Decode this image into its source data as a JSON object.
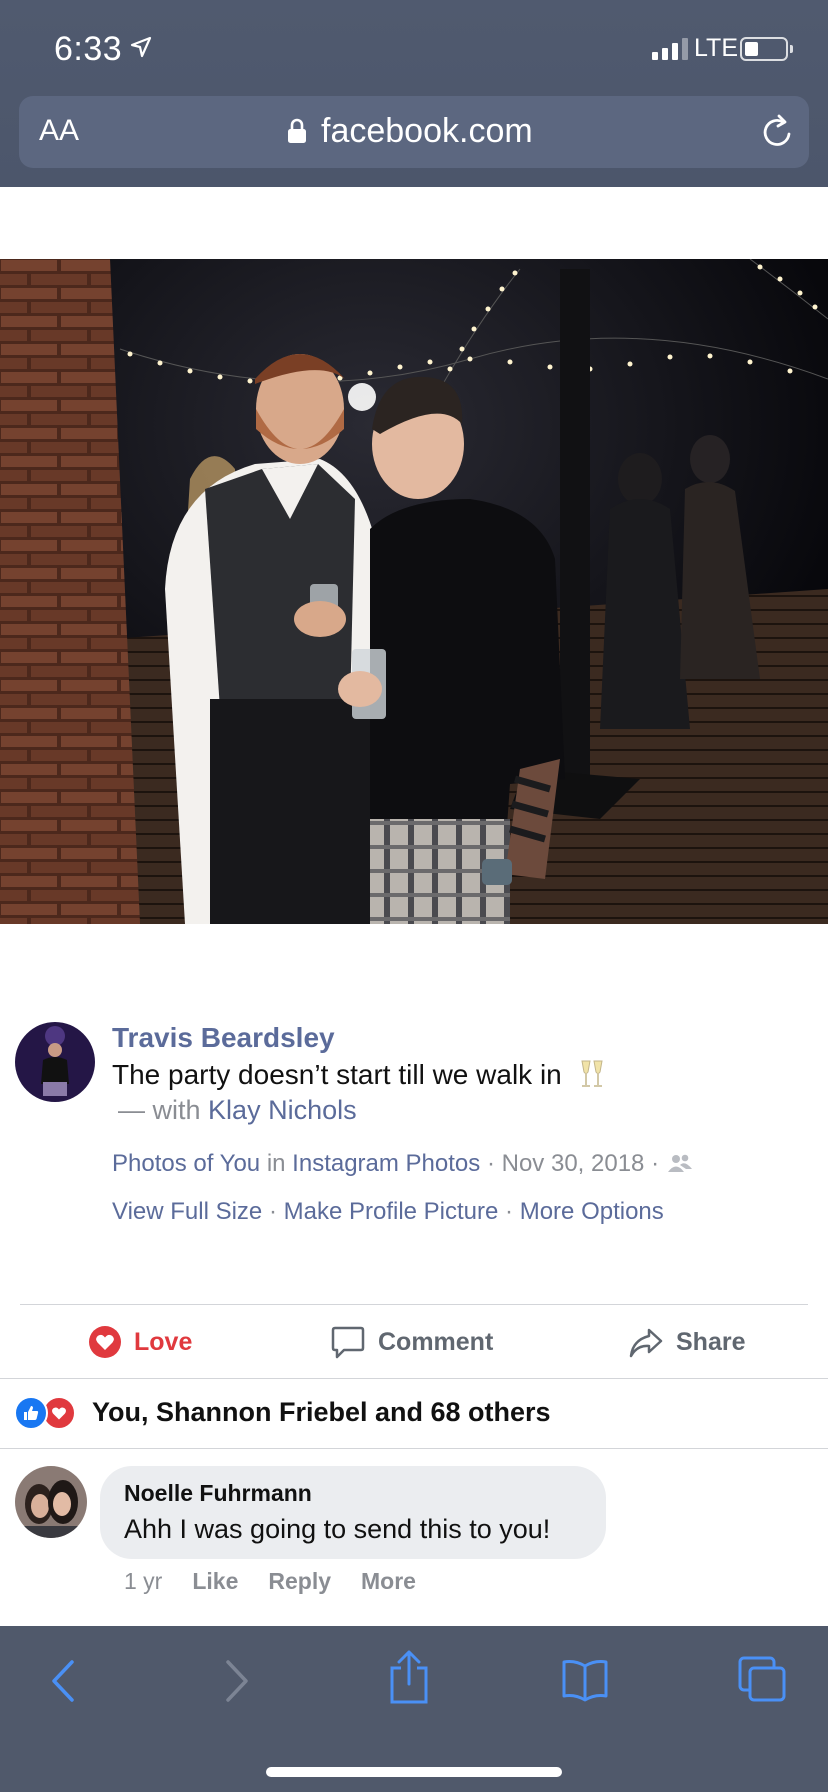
{
  "status_bar": {
    "time": "6:33",
    "network": "LTE"
  },
  "browser": {
    "text_size_label": "AA",
    "url": "facebook.com"
  },
  "post": {
    "author": "Travis Beardsley",
    "caption": "The party doesn’t start till we walk in",
    "caption_emoji": "champagne-glasses-icon",
    "with_prefix": "—  with",
    "tagged": "Klay Nichols",
    "album": "Photos of You",
    "in_label": "in",
    "source": "Instagram Photos",
    "date": "Nov 30, 2018",
    "separator": "·",
    "options": {
      "view_full_size": "View Full Size",
      "make_profile_picture": "Make Profile Picture",
      "more_options": "More Options"
    }
  },
  "actions": {
    "love": "Love",
    "comment": "Comment",
    "share": "Share"
  },
  "reactions": {
    "summary": "You, Shannon Friebel and 68 others",
    "icons": [
      "like-icon",
      "love-icon"
    ]
  },
  "comments": [
    {
      "author": "Noelle Fuhrmann",
      "text": "Ahh I was going to send this to you!",
      "time": "1 yr",
      "like": "Like",
      "reply": "Reply",
      "more": "More"
    }
  ],
  "colors": {
    "chrome": "#4f596d",
    "link": "#5b6b9a",
    "love": "#e0393e",
    "like_blue": "#1877f2",
    "toolbar_icon": "#4a90f5"
  }
}
